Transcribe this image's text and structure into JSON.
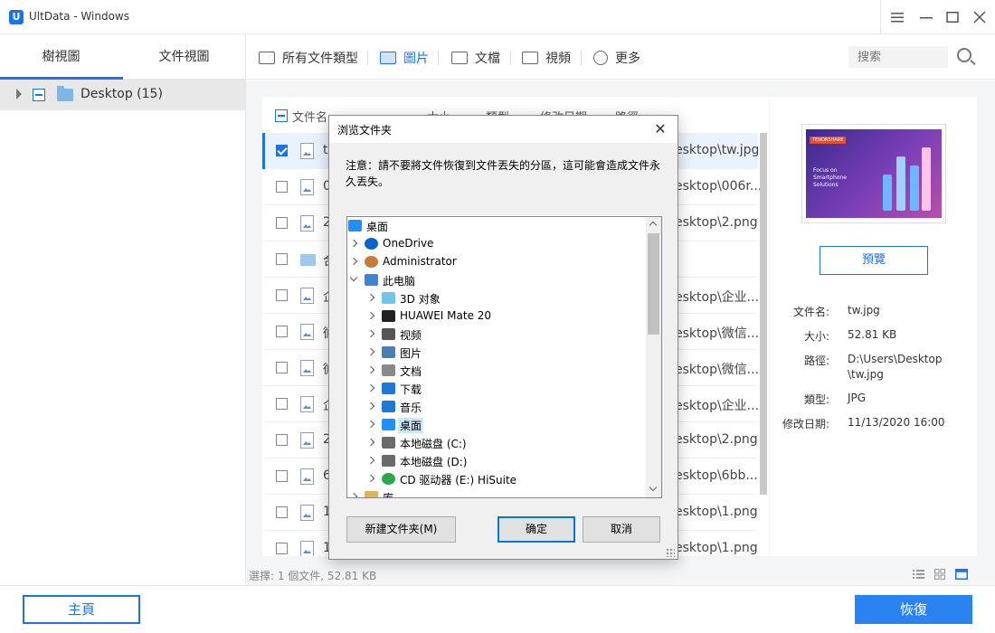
{
  "window": {
    "title": "UltData - Windows",
    "logo": "U"
  },
  "left_panel": {
    "tabs": [
      {
        "label": "樹視圖",
        "active": true
      },
      {
        "label": "文件視圖",
        "active": false
      }
    ],
    "tree": {
      "label": "Desktop (15)"
    }
  },
  "toolbar": {
    "filters": [
      {
        "label": "所有文件類型",
        "icon": "folder-icon"
      },
      {
        "label": "圖片",
        "icon": "image-icon",
        "active": true
      },
      {
        "label": "文檔",
        "icon": "folder-icon"
      },
      {
        "label": "視頻",
        "icon": "video-icon"
      },
      {
        "label": "更多",
        "icon": "chevron-down-circle-icon"
      }
    ],
    "search_placeholder": "搜索"
  },
  "file_list": {
    "columns": [
      "文件名",
      "大小",
      "類型",
      "修改日期",
      "路徑"
    ],
    "rows": [
      {
        "name": "tw",
        "path": "esktop\\tw.jpg",
        "checked": true,
        "type": "image"
      },
      {
        "name": "0",
        "path": "esktop\\006r...",
        "checked": false,
        "type": "image"
      },
      {
        "name": "2",
        "path": "esktop\\2.png",
        "checked": false,
        "type": "image"
      },
      {
        "name": "合",
        "path": "",
        "checked": false,
        "type": "folder"
      },
      {
        "name": "企",
        "path": "esktop\\企业...",
        "checked": false,
        "type": "image"
      },
      {
        "name": "微",
        "path": "esktop\\微信...",
        "checked": false,
        "type": "image"
      },
      {
        "name": "微",
        "path": "esktop\\微信...",
        "checked": false,
        "type": "image"
      },
      {
        "name": "企",
        "path": "esktop\\企业...",
        "checked": false,
        "type": "image"
      },
      {
        "name": "2",
        "path": "esktop\\2.png",
        "checked": false,
        "type": "image"
      },
      {
        "name": "6",
        "path": "esktop\\6bb...",
        "checked": false,
        "type": "image"
      },
      {
        "name": "1",
        "path": "esktop\\1.png",
        "checked": false,
        "type": "image"
      },
      {
        "name": "1",
        "path": "esktop\\1.png",
        "checked": false,
        "type": "image"
      }
    ]
  },
  "preview": {
    "thumb_brand": "TENORSHARE",
    "thumb_text": "Focus on Smartphone Solutions",
    "preview_button": "預覽",
    "info": [
      {
        "label": "文件名:",
        "value": "tw.jpg"
      },
      {
        "label": "大小:",
        "value": "52.81 KB"
      },
      {
        "label": "路徑:",
        "value": "D:\\Users\\Desktop\\tw.jpg"
      },
      {
        "label": "類型:",
        "value": "JPG"
      },
      {
        "label": "修改日期:",
        "value": "11/13/2020 16:00"
      }
    ]
  },
  "status": {
    "text": "選擇: 1 個文件, 52.81 KB"
  },
  "bottom": {
    "home_button": "主頁",
    "recover_button": "恢復"
  },
  "dialog": {
    "title": "浏览文件夹",
    "note": "注意：請不要將文件恢復到文件丟失的分區，這可能會造成文件永久丟失。",
    "tree": [
      {
        "label": "桌面",
        "level": 0,
        "icon": "desktop-icon",
        "chevron": "none"
      },
      {
        "label": "OneDrive",
        "level": 1,
        "icon": "cloud-icon",
        "chevron": "right"
      },
      {
        "label": "Administrator",
        "level": 1,
        "icon": "user-icon",
        "chevron": "right"
      },
      {
        "label": "此电脑",
        "level": 1,
        "icon": "computer-icon",
        "chevron": "down"
      },
      {
        "label": "3D 对象",
        "level": 2,
        "icon": "cube-icon",
        "chevron": "right"
      },
      {
        "label": "HUAWEI Mate 20",
        "level": 2,
        "icon": "phone-icon",
        "chevron": "right"
      },
      {
        "label": "视频",
        "level": 2,
        "icon": "video-icon",
        "chevron": "right"
      },
      {
        "label": "图片",
        "level": 2,
        "icon": "image-icon",
        "chevron": "right"
      },
      {
        "label": "文档",
        "level": 2,
        "icon": "document-icon",
        "chevron": "right"
      },
      {
        "label": "下载",
        "level": 2,
        "icon": "download-icon",
        "chevron": "right"
      },
      {
        "label": "音乐",
        "level": 2,
        "icon": "music-icon",
        "chevron": "right"
      },
      {
        "label": "桌面",
        "level": 2,
        "icon": "desktop-icon",
        "chevron": "right",
        "selected": true
      },
      {
        "label": "本地磁盘 (C:)",
        "level": 2,
        "icon": "disk-icon",
        "chevron": "right"
      },
      {
        "label": "本地磁盘 (D:)",
        "level": 2,
        "icon": "disk-icon",
        "chevron": "right"
      },
      {
        "label": "CD 驱动器 (E:) HiSuite",
        "level": 2,
        "icon": "cd-icon",
        "chevron": "right"
      },
      {
        "label": "库",
        "level": 1,
        "icon": "library-icon",
        "chevron": "right"
      }
    ],
    "new_folder_button": "新建文件夹(M)",
    "ok_button": "确定",
    "cancel_button": "取消"
  },
  "colors": {
    "accent": "#1a73e8",
    "recover_bg": "#2a83f0",
    "dialog_bg": "#f0f0f0",
    "selection": "#cce8ff"
  }
}
